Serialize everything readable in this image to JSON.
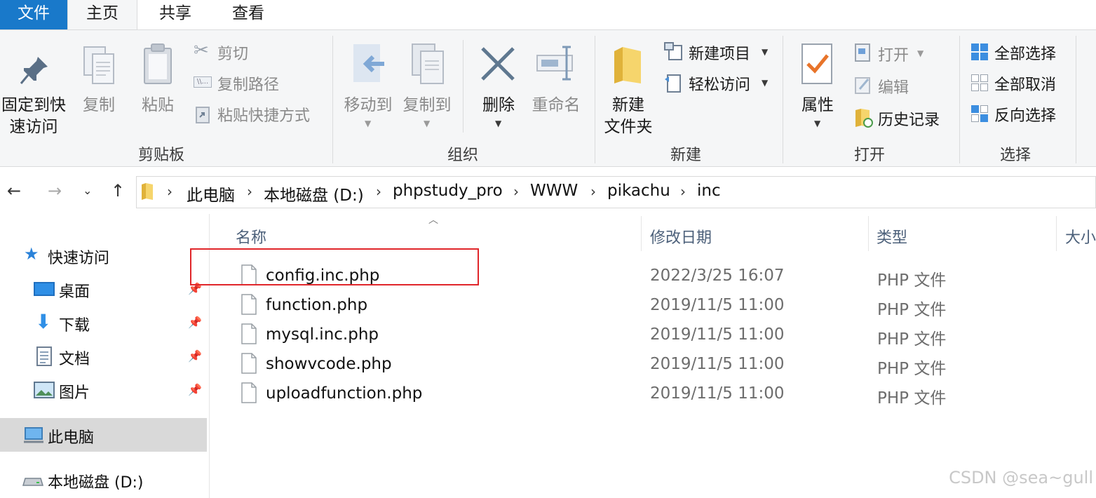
{
  "tabs": [
    {
      "label": "文件"
    },
    {
      "label": "主页"
    },
    {
      "label": "共享"
    },
    {
      "label": "查看"
    }
  ],
  "ribbon": {
    "clipboard": {
      "pin_label": "固定到快\n速访问",
      "pin_line1": "固定到快",
      "pin_line2": "速访问",
      "copy": "复制",
      "paste": "粘贴",
      "cut": "剪切",
      "copy_path": "复制路径",
      "paste_shortcut": "粘贴快捷方式",
      "group": "剪贴板"
    },
    "organize": {
      "move_to": "移动到",
      "copy_to": "复制到",
      "delete": "删除",
      "rename": "重命名",
      "group": "组织"
    },
    "new": {
      "new_folder_line1": "新建",
      "new_folder_line2": "文件夹",
      "new_item": "新建项目",
      "easy_access": "轻松访问",
      "group": "新建"
    },
    "open": {
      "properties": "属性",
      "open": "打开",
      "edit": "编辑",
      "history": "历史记录",
      "group": "打开"
    },
    "select": {
      "select_all": "全部选择",
      "select_none": "全部取消",
      "invert": "反向选择",
      "group": "选择"
    }
  },
  "address": {
    "crumbs": [
      "此电脑",
      "本地磁盘 (D:)",
      "phpstudy_pro",
      "WWW",
      "pikachu",
      "inc"
    ]
  },
  "nav": {
    "quick_access": "快速访问",
    "desktop": "桌面",
    "downloads": "下载",
    "documents": "文档",
    "pictures": "图片",
    "this_pc": "此电脑",
    "local_disk": "本地磁盘 (D:)"
  },
  "columns": {
    "name": "名称",
    "modified": "修改日期",
    "type": "类型",
    "size": "大小"
  },
  "files": [
    {
      "name": "config.inc.php",
      "date": "2022/3/25 16:07",
      "type": "PHP 文件"
    },
    {
      "name": "function.php",
      "date": "2019/11/5 11:00",
      "type": "PHP 文件"
    },
    {
      "name": "mysql.inc.php",
      "date": "2019/11/5 11:00",
      "type": "PHP 文件"
    },
    {
      "name": "showvcode.php",
      "date": "2019/11/5 11:00",
      "type": "PHP 文件"
    },
    {
      "name": "uploadfunction.php",
      "date": "2019/11/5 11:00",
      "type": "PHP 文件"
    }
  ],
  "watermark": "CSDN @sea~gull",
  "colors": {
    "accent": "#1979ca",
    "highlight": "#e0262a"
  }
}
